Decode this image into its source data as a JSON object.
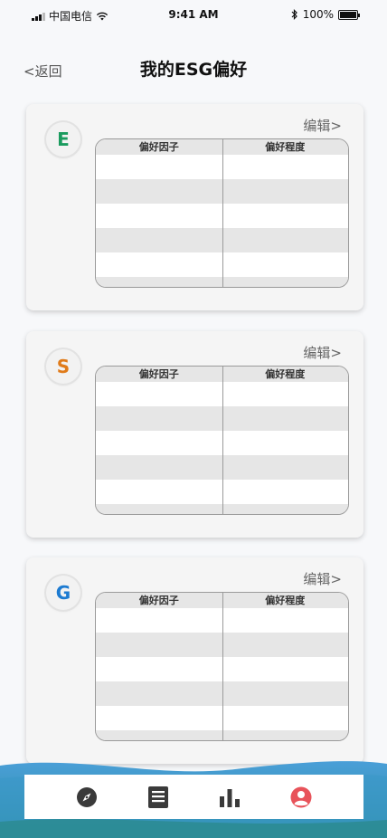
{
  "status_bar": {
    "carrier": "中国电信",
    "time": "9:41 AM",
    "battery": "100%"
  },
  "header": {
    "back_label": "<返回",
    "title": "我的ESG偏好"
  },
  "cards": [
    {
      "letter": "E",
      "letter_color": "#1a9b5e",
      "edit_label": "编辑>",
      "col_factor": "偏好因子",
      "col_degree": "偏好程度"
    },
    {
      "letter": "S",
      "letter_color": "#e07b1a",
      "edit_label": "编辑>",
      "col_factor": "偏好因子",
      "col_degree": "偏好程度"
    },
    {
      "letter": "G",
      "letter_color": "#1d7bd1",
      "edit_label": "编辑>",
      "col_factor": "偏好因子",
      "col_degree": "偏好程度"
    }
  ],
  "tab_bar": {
    "items": [
      {
        "icon": "compass-icon",
        "active": false
      },
      {
        "icon": "list-icon",
        "active": false
      },
      {
        "icon": "bar-chart-icon",
        "active": false
      },
      {
        "icon": "user-icon",
        "active": true
      }
    ],
    "active_color": "#e8535a",
    "inactive_color": "#3a3a3a"
  }
}
